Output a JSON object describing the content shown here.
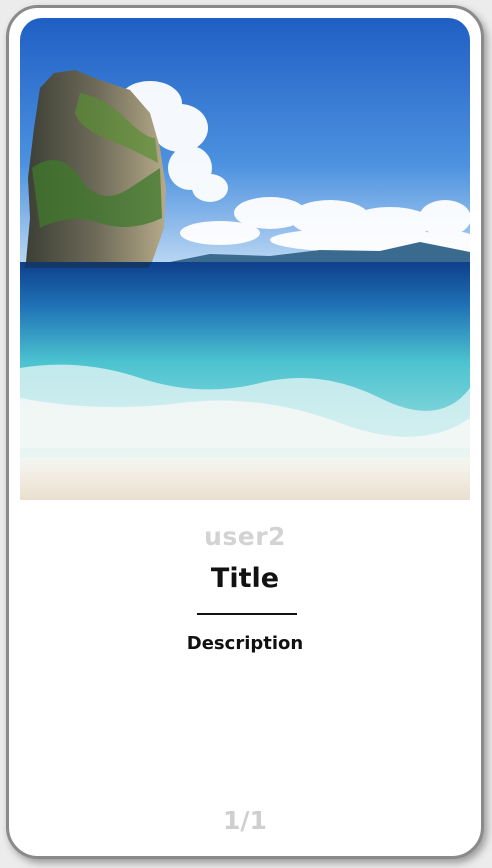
{
  "card": {
    "image_icon": "beach-photo",
    "username": "user2",
    "title": "Title",
    "description": "Description",
    "page_indicator": "1/1"
  },
  "colors": {
    "card_border": "#8a8a8a",
    "username": "#d3d3d3",
    "text": "#111111",
    "page_indicator": "#cfcfcf"
  }
}
